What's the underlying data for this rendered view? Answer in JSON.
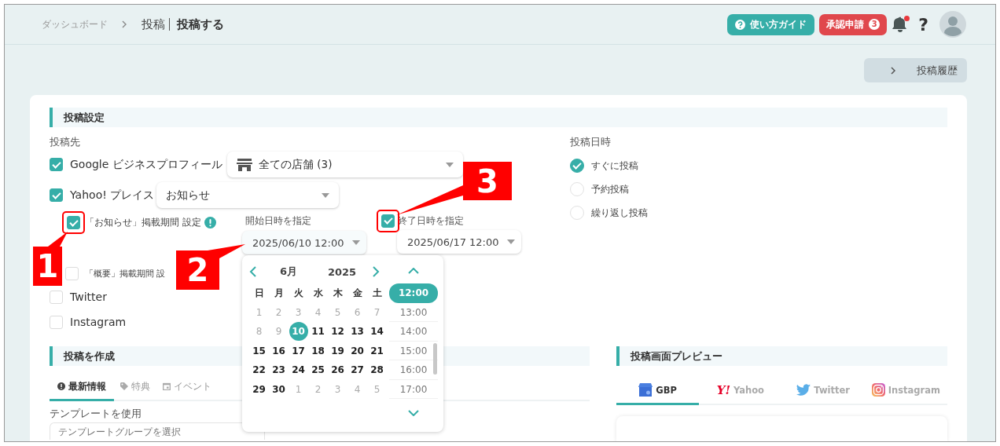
{
  "header": {
    "breadcrumb": [
      {
        "label": "ダッシュボード"
      },
      {
        "label": "投稿"
      }
    ],
    "page_title": "投稿する",
    "guide_button": "使い方ガイド",
    "approval_button": {
      "label": "承認申請",
      "count": "3"
    },
    "notifications": {
      "unread": true
    },
    "help": "?"
  },
  "history_button": "投稿履歴",
  "settings": {
    "title": "投稿設定",
    "destinations_label": "投稿先",
    "destinations": [
      {
        "kind": "store",
        "label": "Google ビジネスプロフィール",
        "checked": true,
        "value": "全ての店舗 (3)"
      },
      {
        "kind": "select",
        "label": "Yahoo! プレイス",
        "checked": true,
        "value": "お知らせ"
      },
      {
        "kind": "period",
        "label": "「お知らせ」掲載期間 設定",
        "checked": true,
        "highlighted": true,
        "start_label": "開始日時を指定",
        "start_value": "2025/06/10 12:00",
        "end_checked": true,
        "end_highlighted": true,
        "end_label": "終了日時を指定",
        "end_value": "2025/06/17 12:00"
      },
      {
        "kind": "sub",
        "label": "「概要」掲載期間 設",
        "checked": false
      },
      {
        "kind": "plain",
        "label": "Twitter",
        "checked": false
      },
      {
        "kind": "plain",
        "label": "Instagram",
        "checked": false
      }
    ],
    "schedule": {
      "label": "投稿日時",
      "options": [
        {
          "label": "すぐに投稿",
          "selected": true
        },
        {
          "label": "予約投稿",
          "selected": false
        },
        {
          "label": "繰り返し投稿",
          "selected": false
        }
      ]
    }
  },
  "calendar": {
    "month": "6月",
    "year": "2025",
    "weekdays": [
      "日",
      "月",
      "火",
      "水",
      "木",
      "金",
      "土"
    ],
    "days": [
      {
        "label": "1",
        "muted": true,
        "selected": false
      },
      {
        "label": "2",
        "muted": true,
        "selected": false
      },
      {
        "label": "3",
        "muted": true,
        "selected": false
      },
      {
        "label": "4",
        "muted": true,
        "selected": false
      },
      {
        "label": "5",
        "muted": true,
        "selected": false
      },
      {
        "label": "6",
        "muted": true,
        "selected": false
      },
      {
        "label": "7",
        "muted": true,
        "selected": false
      },
      {
        "label": "8",
        "muted": true,
        "selected": false
      },
      {
        "label": "9",
        "muted": true,
        "selected": false
      },
      {
        "label": "10",
        "muted": false,
        "selected": true
      },
      {
        "label": "11",
        "muted": false,
        "selected": false
      },
      {
        "label": "12",
        "muted": false,
        "selected": false
      },
      {
        "label": "13",
        "muted": false,
        "selected": false
      },
      {
        "label": "14",
        "muted": false,
        "selected": false
      },
      {
        "label": "15",
        "muted": false,
        "selected": false
      },
      {
        "label": "16",
        "muted": false,
        "selected": false
      },
      {
        "label": "17",
        "muted": false,
        "selected": false
      },
      {
        "label": "18",
        "muted": false,
        "selected": false
      },
      {
        "label": "19",
        "muted": false,
        "selected": false
      },
      {
        "label": "20",
        "muted": false,
        "selected": false
      },
      {
        "label": "21",
        "muted": false,
        "selected": false
      },
      {
        "label": "22",
        "muted": false,
        "selected": false
      },
      {
        "label": "23",
        "muted": false,
        "selected": false
      },
      {
        "label": "24",
        "muted": false,
        "selected": false
      },
      {
        "label": "25",
        "muted": false,
        "selected": false
      },
      {
        "label": "26",
        "muted": false,
        "selected": false
      },
      {
        "label": "27",
        "muted": false,
        "selected": false
      },
      {
        "label": "28",
        "muted": false,
        "selected": false
      },
      {
        "label": "29",
        "muted": false,
        "selected": false
      },
      {
        "label": "30",
        "muted": false,
        "selected": false
      },
      {
        "label": "1",
        "muted": true,
        "selected": false
      },
      {
        "label": "2",
        "muted": true,
        "selected": false
      },
      {
        "label": "3",
        "muted": true,
        "selected": false
      },
      {
        "label": "4",
        "muted": true,
        "selected": false
      },
      {
        "label": "5",
        "muted": true,
        "selected": false
      }
    ],
    "times": [
      {
        "label": "12:00",
        "selected": true
      },
      {
        "label": "13:00",
        "selected": false
      },
      {
        "label": "14:00",
        "selected": false
      },
      {
        "label": "15:00",
        "selected": false
      },
      {
        "label": "16:00",
        "selected": false
      },
      {
        "label": "17:00",
        "selected": false
      }
    ]
  },
  "compose": {
    "title": "投稿を作成",
    "tabs": [
      {
        "kind": "info",
        "label": "最新情報",
        "selected": true
      },
      {
        "kind": "tag",
        "label": "特典",
        "selected": false
      },
      {
        "kind": "event",
        "label": "イベント",
        "selected": false
      }
    ],
    "template_label": "テンプレートを使用",
    "template_placeholder": "テンプレートグループを選択"
  },
  "preview": {
    "title": "投稿画面プレビュー",
    "tabs": [
      {
        "kind": "gbp",
        "label": "GBP",
        "selected": true
      },
      {
        "kind": "yahoo",
        "logo": "Y!",
        "label": "Yahoo",
        "selected": false
      },
      {
        "kind": "twitter",
        "label": "Twitter",
        "selected": false
      },
      {
        "kind": "instagram",
        "label": "Instagram",
        "selected": false
      }
    ]
  },
  "callouts": [
    {
      "number": "1"
    },
    {
      "number": "2"
    },
    {
      "number": "3"
    }
  ]
}
